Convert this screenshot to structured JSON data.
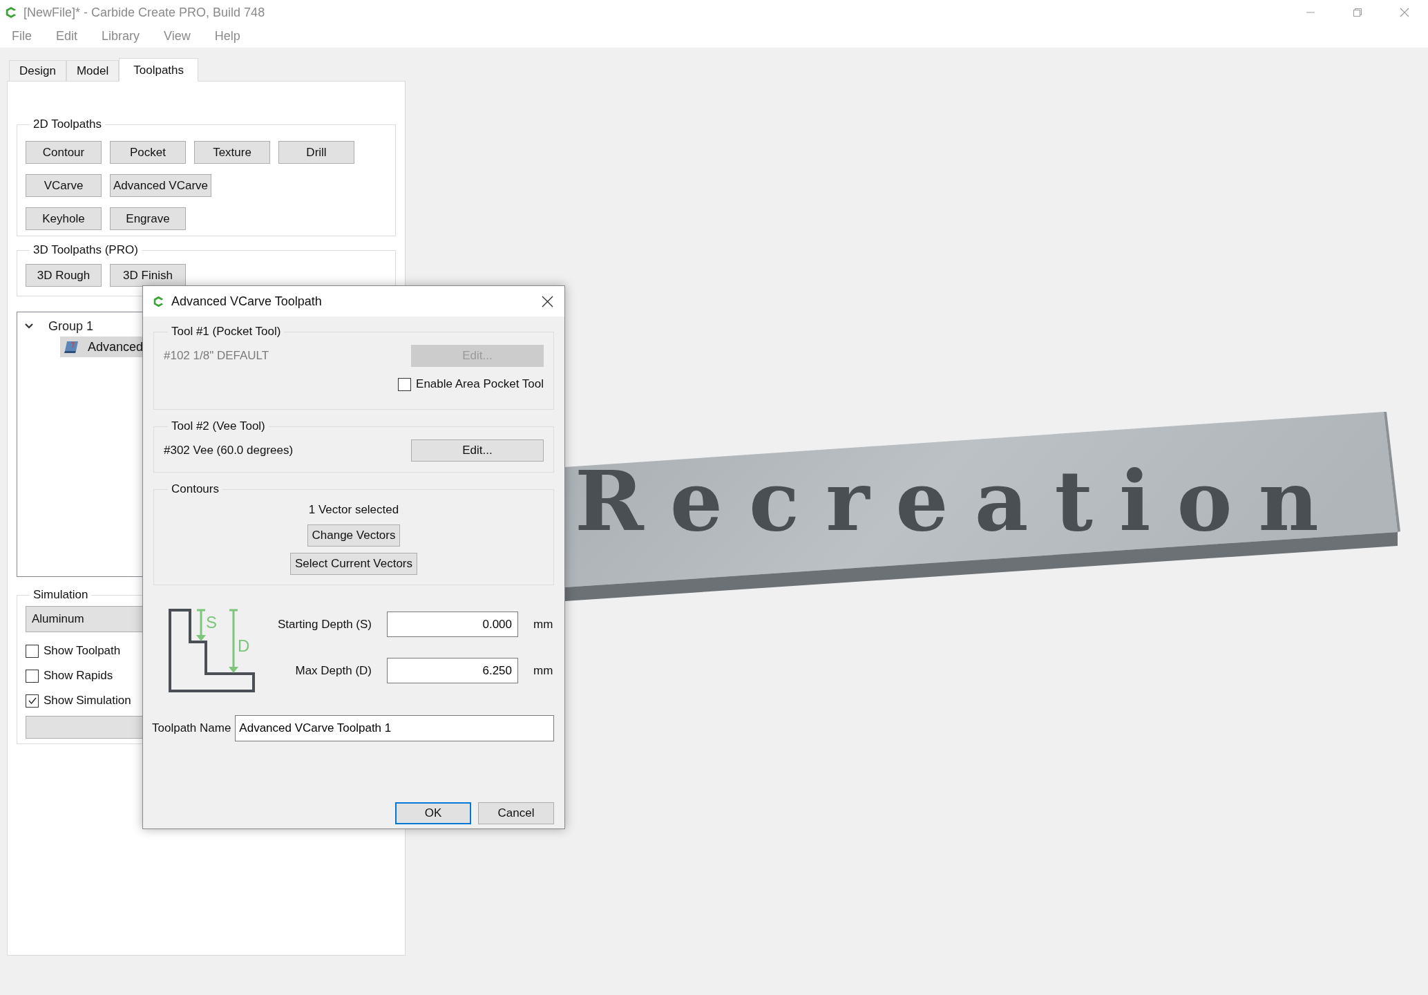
{
  "window": {
    "title": "[NewFile]* - Carbide Create PRO, Build 748"
  },
  "menu": [
    "File",
    "Edit",
    "Library",
    "View",
    "Help"
  ],
  "tabs": [
    {
      "label": "Design",
      "selected": false
    },
    {
      "label": "Model",
      "selected": false
    },
    {
      "label": "Toolpaths",
      "selected": true
    }
  ],
  "toolpaths_2d": {
    "title": "2D Toolpaths",
    "rows": [
      [
        "Contour",
        "Pocket",
        "Texture",
        "Drill"
      ],
      [
        "VCarve",
        "Advanced VCarve"
      ],
      [
        "Keyhole",
        "Engrave"
      ]
    ]
  },
  "toolpaths_3d": {
    "title": "3D Toolpaths (PRO)",
    "buttons": [
      "3D Rough",
      "3D Finish"
    ]
  },
  "toolpath_tree": [
    {
      "label": "Group 1",
      "expanded": true,
      "children": [
        {
          "label": "Advanced",
          "selected": true
        }
      ]
    }
  ],
  "simulation": {
    "title": "Simulation",
    "material": "Aluminum",
    "options": [
      {
        "label": "Show Toolpath",
        "checked": false
      },
      {
        "label": "Show Rapids",
        "checked": false
      },
      {
        "label": "Show Simulation",
        "checked": true
      }
    ]
  },
  "viewport": {
    "model_text": "Recreation"
  },
  "dialog": {
    "title": "Advanced VCarve Toolpath",
    "tool_1": {
      "title": "Tool #1 (Pocket Tool)",
      "tool": "#102 1/8\" DEFAULT",
      "disabled": true,
      "edit_button": "Edit...",
      "area_pocket": {
        "label": "Enable Area Pocket Tool",
        "checked": false
      }
    },
    "tool_2": {
      "title": "Tool #2 (Vee Tool)",
      "tool": "#302 Vee (60.0 degrees)",
      "disabled": false,
      "edit_button": "Edit..."
    },
    "contours": {
      "title": "Contours",
      "status": "1 Vector selected",
      "buttons": [
        "Change Vectors",
        "Select Current Vectors"
      ]
    },
    "depths": [
      {
        "label": "Starting Depth (S)",
        "symbol": "S",
        "value": "0.000",
        "unit": "mm"
      },
      {
        "label": "Max Depth (D)",
        "symbol": "D",
        "value": "6.250",
        "unit": "mm"
      }
    ],
    "toolpath_name": {
      "label": "Toolpath Name",
      "value": "Advanced VCarve Toolpath 1"
    },
    "buttons": [
      {
        "label": "OK",
        "default": true
      },
      {
        "label": "Cancel",
        "default": false
      }
    ]
  }
}
